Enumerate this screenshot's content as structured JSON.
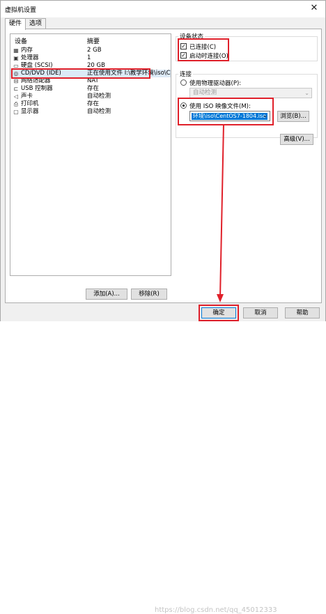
{
  "window": {
    "title": "虚拟机设置",
    "close_glyph": "✕"
  },
  "tabs": [
    {
      "label": "硬件",
      "active": true
    },
    {
      "label": "选项",
      "active": false
    }
  ],
  "device_list": {
    "header_device": "设备",
    "header_summary": "摘要",
    "items": [
      {
        "icon": "memory-icon",
        "glyph": "▦",
        "name": "内存",
        "summary": "2 GB"
      },
      {
        "icon": "processor-icon",
        "glyph": "▣",
        "name": "处理器",
        "summary": "1"
      },
      {
        "icon": "harddisk-icon",
        "glyph": "▭",
        "name": "硬盘 (SCSI)",
        "summary": "20 GB"
      },
      {
        "icon": "cdrom-icon",
        "glyph": "◎",
        "name": "CD/DVD (IDE)",
        "summary": "正在使用文件 I:\\教学环境\\iso\\C..."
      },
      {
        "icon": "network-icon",
        "glyph": "⊟",
        "name": "网络适配器",
        "summary": "NAT"
      },
      {
        "icon": "usb-icon",
        "glyph": "⊏",
        "name": "USB 控制器",
        "summary": "存在"
      },
      {
        "icon": "sound-icon",
        "glyph": "◁",
        "name": "声卡",
        "summary": "自动检测"
      },
      {
        "icon": "printer-icon",
        "glyph": "⎙",
        "name": "打印机",
        "summary": "存在"
      },
      {
        "icon": "display-icon",
        "glyph": "▢",
        "name": "显示器",
        "summary": "自动检测"
      }
    ],
    "add_button": "添加(A)...",
    "remove_button": "移除(R)"
  },
  "device_status": {
    "title": "设备状态",
    "connected": {
      "label": "已连接(C)",
      "checked": true
    },
    "connect_at_power_on": {
      "label": "启动时连接(O)",
      "checked": true
    }
  },
  "connection": {
    "title": "连接",
    "physical_drive": {
      "label": "使用物理驱动器(P):",
      "selected": false
    },
    "physical_drive_value": "自动检测",
    "iso_image": {
      "label": "使用 ISO 映像文件(M):",
      "selected": true
    },
    "iso_path": "环境\\iso\\CentOS7-1804.iso",
    "browse_button": "浏览(B)...",
    "advanced_button": "高级(V)..."
  },
  "footer": {
    "ok_button": "确定",
    "cancel_button": "取消",
    "help_button": "帮助",
    "watermark": "https://blog.csdn.net/qq_45012333"
  },
  "colors": {
    "highlight_red": "#e0202a",
    "selection_blue": "#0078d7"
  }
}
